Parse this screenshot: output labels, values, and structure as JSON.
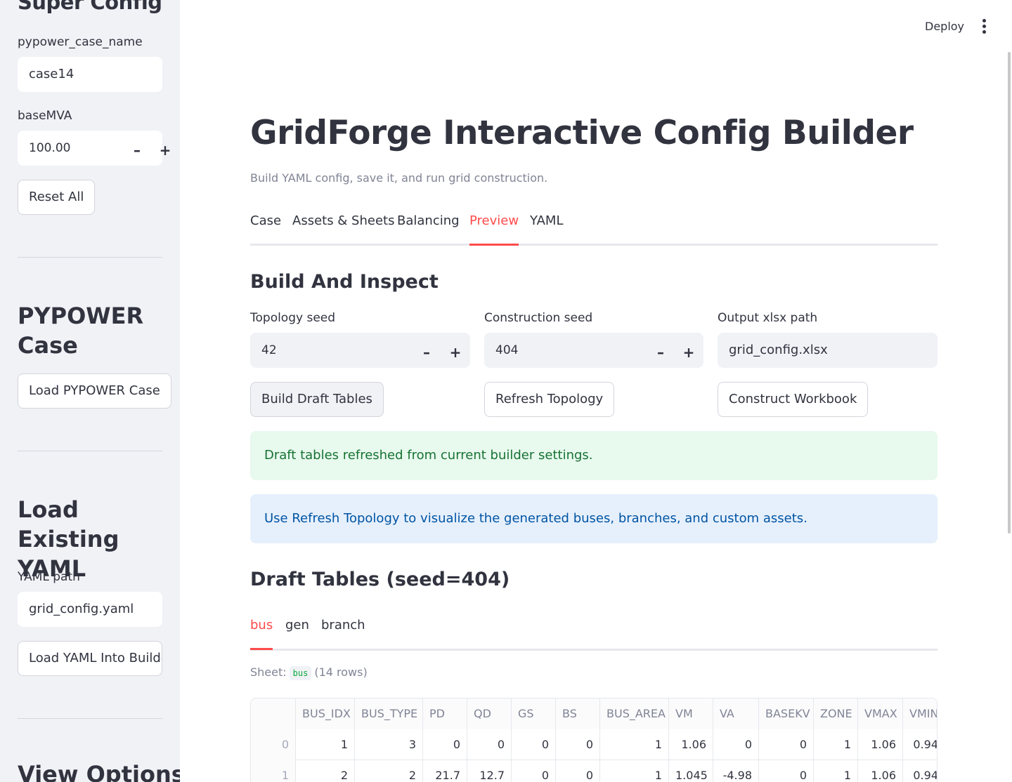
{
  "sidebar": {
    "title": "Super Config",
    "case_name_label": "pypower_case_name",
    "case_name_value": "case14",
    "basemva_label": "baseMVA",
    "basemva_value": "100.00",
    "stepper_minus": "–",
    "stepper_plus": "+",
    "reset_label": "Reset All",
    "pypower_heading": "PYPOWER Case",
    "load_pypower_label": "Load PYPOWER Case",
    "yaml_heading": "Load Existing YAML",
    "yaml_path_label": "YAML path",
    "yaml_path_value": "grid_config.yaml",
    "load_yaml_label": "Load YAML Into Builder",
    "view_options_heading": "View Options"
  },
  "header": {
    "deploy_label": "Deploy"
  },
  "main": {
    "title": "GridForge Interactive Config Builder",
    "caption": "Build YAML config, save it, and run grid construction.",
    "tabs": [
      {
        "label": "Case"
      },
      {
        "label": "Assets & Sheets"
      },
      {
        "label": "Balancing"
      },
      {
        "label": "Preview"
      },
      {
        "label": "YAML"
      }
    ],
    "active_tab": "Preview",
    "build_heading": "Build And Inspect",
    "topology_seed_label": "Topology seed",
    "topology_seed_value": "42",
    "construction_seed_label": "Construction seed",
    "construction_seed_value": "404",
    "output_path_label": "Output xlsx path",
    "output_path_value": "grid_config.xlsx",
    "build_draft_label": "Build Draft Tables",
    "refresh_topology_label": "Refresh Topology",
    "construct_workbook_label": "Construct Workbook",
    "success_message": "Draft tables refreshed from current builder settings.",
    "info_message": "Use Refresh Topology to visualize the generated buses, branches, and custom assets.",
    "draft_heading": "Draft Tables (seed=404)",
    "subtabs": [
      {
        "label": "bus"
      },
      {
        "label": "gen"
      },
      {
        "label": "branch"
      }
    ],
    "active_subtab": "bus",
    "sheet_prefix": "Sheet:",
    "sheet_name": "bus",
    "sheet_rows": "(14 rows)",
    "table": {
      "columns": [
        "",
        "BUS_IDX",
        "BUS_TYPE",
        "PD",
        "QD",
        "GS",
        "BS",
        "BUS_AREA",
        "VM",
        "VA",
        "BASEKV",
        "ZONE",
        "VMAX",
        "VMIN"
      ],
      "rows": [
        [
          "0",
          "1",
          "3",
          "0",
          "0",
          "0",
          "0",
          "1",
          "1.06",
          "0",
          "0",
          "1",
          "1.06",
          "0.94"
        ],
        [
          "1",
          "2",
          "2",
          "21.7",
          "12.7",
          "0",
          "0",
          "1",
          "1.045",
          "-4.98",
          "0",
          "1",
          "1.06",
          "0.94"
        ]
      ]
    }
  }
}
